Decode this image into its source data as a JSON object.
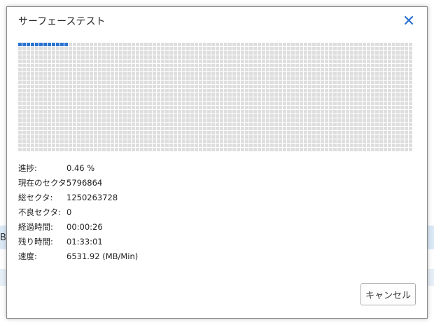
{
  "dialog": {
    "title": "サーフェーステスト",
    "close_icon": "close-x-icon",
    "accent_color": "#2b73d1"
  },
  "progress": {
    "percent": 0.46,
    "completed_color": "#2b73d1",
    "pending_color": "#dedede"
  },
  "info": {
    "rows": [
      {
        "label": "進捗:",
        "value": "0.46 %"
      },
      {
        "label": "現在のセクタ:",
        "value": "5796864"
      },
      {
        "label": "総セクタ:",
        "value": "1250263728"
      },
      {
        "label": "不良セクタ:",
        "value": "0"
      },
      {
        "label": "経過時間:",
        "value": "00:00:26"
      },
      {
        "label": "残り時間:",
        "value": "01:33:01"
      },
      {
        "label": "速度:",
        "value": "6531.92 (MB/Min)"
      }
    ]
  },
  "buttons": {
    "cancel_label": "キャンセル"
  },
  "background": {
    "partial_text": "B"
  }
}
